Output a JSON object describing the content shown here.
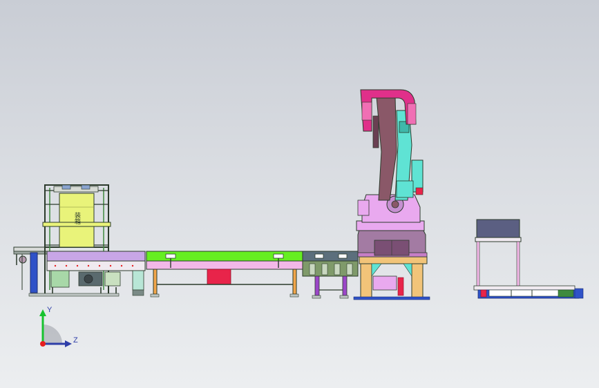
{
  "scene": {
    "colors": {
      "background_top": "#c9cdd5",
      "background_bottom": "#eceef0",
      "frame_outline": "#2b3a2b",
      "stacker_yellow": "#e9f37a",
      "conveyor_green": "#66ee22",
      "conveyor_pink": "#f3b8e8",
      "robot_magenta": "#e0308a",
      "robot_cyan": "#5fe3d4",
      "robot_brown": "#8a5868",
      "robot_lilac": "#e9a9ef",
      "pedestal_orange": "#f2c479",
      "pallet_blue": "#2f52c8",
      "table_top": "#5b5f82",
      "accent_red": "#e8244a"
    },
    "stacker_label": "装箱"
  },
  "triad": {
    "y_label": "Y",
    "z_label": "Z",
    "y_color": "#17c22e",
    "z_color": "#2e3ea8",
    "origin_color": "#e61f1f"
  }
}
